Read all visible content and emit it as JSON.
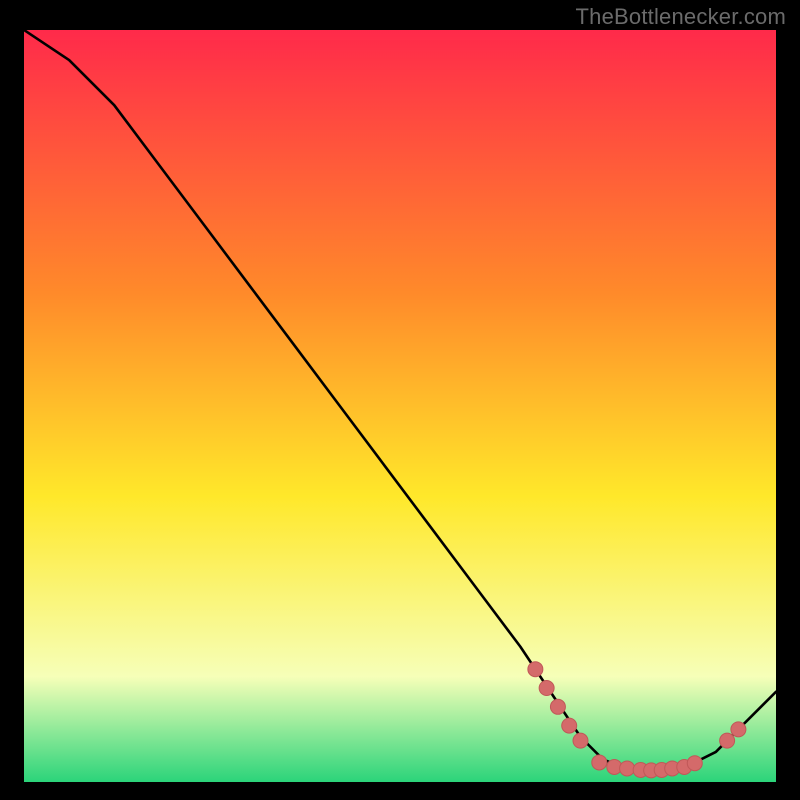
{
  "watermark": "TheBottlenecker.com",
  "colors": {
    "gradient_top": "#ff2a4a",
    "gradient_mid1": "#ff8a2a",
    "gradient_mid2": "#ffe82a",
    "gradient_mid3": "#f6ffb8",
    "gradient_bottom": "#2bd47a",
    "curve": "#000000",
    "marker_fill": "#d46a6a",
    "marker_stroke": "#c05858",
    "frame": "#000000"
  },
  "chart_data": {
    "type": "line",
    "title": "",
    "xlabel": "",
    "ylabel": "",
    "xlim": [
      0,
      100
    ],
    "ylim": [
      0,
      100
    ],
    "grid": false,
    "legend": false,
    "curve": [
      {
        "x": 0,
        "y": 100
      },
      {
        "x": 6,
        "y": 96
      },
      {
        "x": 12,
        "y": 90
      },
      {
        "x": 18,
        "y": 82
      },
      {
        "x": 24,
        "y": 74
      },
      {
        "x": 30,
        "y": 66
      },
      {
        "x": 36,
        "y": 58
      },
      {
        "x": 42,
        "y": 50
      },
      {
        "x": 48,
        "y": 42
      },
      {
        "x": 54,
        "y": 34
      },
      {
        "x": 60,
        "y": 26
      },
      {
        "x": 66,
        "y": 18
      },
      {
        "x": 70,
        "y": 12
      },
      {
        "x": 74,
        "y": 6
      },
      {
        "x": 77,
        "y": 3
      },
      {
        "x": 80,
        "y": 1.8
      },
      {
        "x": 84,
        "y": 1.5
      },
      {
        "x": 88,
        "y": 2
      },
      {
        "x": 92,
        "y": 4
      },
      {
        "x": 96,
        "y": 8
      },
      {
        "x": 100,
        "y": 12
      }
    ],
    "markers": [
      {
        "x": 68,
        "y": 15
      },
      {
        "x": 69.5,
        "y": 12.5
      },
      {
        "x": 71,
        "y": 10
      },
      {
        "x": 72.5,
        "y": 7.5
      },
      {
        "x": 74,
        "y": 5.5
      },
      {
        "x": 76.5,
        "y": 2.6
      },
      {
        "x": 78.5,
        "y": 2.0
      },
      {
        "x": 80.2,
        "y": 1.8
      },
      {
        "x": 82.0,
        "y": 1.6
      },
      {
        "x": 83.4,
        "y": 1.55
      },
      {
        "x": 84.8,
        "y": 1.6
      },
      {
        "x": 86.2,
        "y": 1.8
      },
      {
        "x": 87.8,
        "y": 2.0
      },
      {
        "x": 89.2,
        "y": 2.5
      },
      {
        "x": 93.5,
        "y": 5.5
      },
      {
        "x": 95.0,
        "y": 7.0
      }
    ]
  }
}
